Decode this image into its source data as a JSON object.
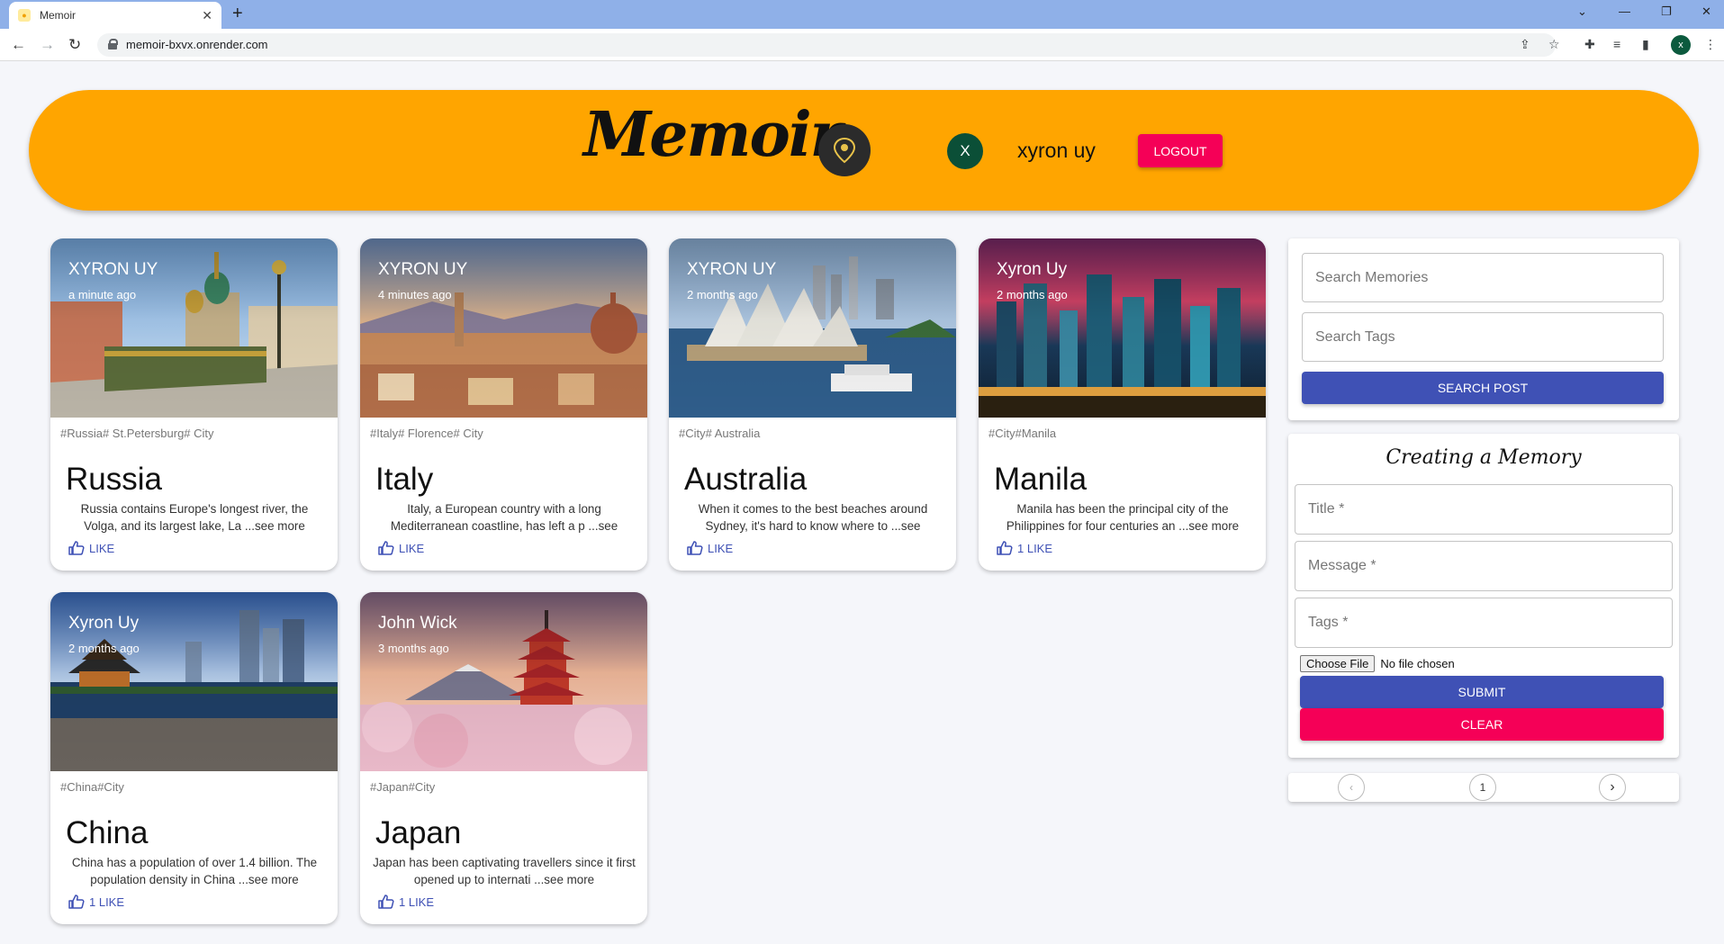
{
  "browser": {
    "tab_title": "Memoir",
    "tab_close": "✕",
    "new_tab": "+",
    "url": "memoir-bxvx.onrender.com",
    "profile_initial": "x"
  },
  "header": {
    "logo_text": "Memoir",
    "user_initial": "X",
    "user_name": "xyron uy",
    "logout_label": "LOGOUT",
    "accent_color": "#ffa500"
  },
  "posts": [
    {
      "author": "XYRON UY",
      "time": "a minute ago",
      "tags": "#Russia# St.Petersburg# City",
      "title": "Russia",
      "message": "Russia contains Europe's longest river, the Volga, and its largest lake, La ...see more",
      "likes": "LIKE"
    },
    {
      "author": "XYRON UY",
      "time": "4 minutes ago",
      "tags": "#Italy# Florence# City",
      "title": "Italy",
      "message": "Italy, a European country with a long Mediterranean coastline, has left a p ...see",
      "likes": "LIKE"
    },
    {
      "author": "XYRON UY",
      "time": "2 months ago",
      "tags": "#City# Australia",
      "title": "Australia",
      "message": "When it comes to the best beaches around Sydney, it's hard to know where to ...see",
      "likes": "LIKE"
    },
    {
      "author": "Xyron Uy",
      "time": "2 months ago",
      "tags": "#City#Manila",
      "title": "Manila",
      "message": "Manila has been the principal city of the Philippines for four centuries an ...see more",
      "likes": "1 LIKE"
    },
    {
      "author": "Xyron Uy",
      "time": "2 months ago",
      "tags": "#China#City",
      "title": "China",
      "message": "China has a population of over 1.4 billion. The population density in China ...see more",
      "likes": "1 LIKE"
    },
    {
      "author": "John Wick",
      "time": "3 months ago",
      "tags": "#Japan#City",
      "title": "Japan",
      "message": "Japan has been captivating travellers since it first opened up to internati ...see more",
      "likes": "1 LIKE"
    }
  ],
  "search": {
    "memories_placeholder": "Search Memories",
    "tags_placeholder": "Search Tags",
    "button_label": "SEARCH POST"
  },
  "form": {
    "heading": "Creating a Memory",
    "title_placeholder": "Title *",
    "message_placeholder": "Message *",
    "tags_placeholder": "Tags *",
    "file_button": "Choose File",
    "file_status": "No file chosen",
    "submit_label": "SUBMIT",
    "clear_label": "CLEAR"
  },
  "pagination": {
    "prev": "‹",
    "page": "1",
    "next": "›"
  }
}
